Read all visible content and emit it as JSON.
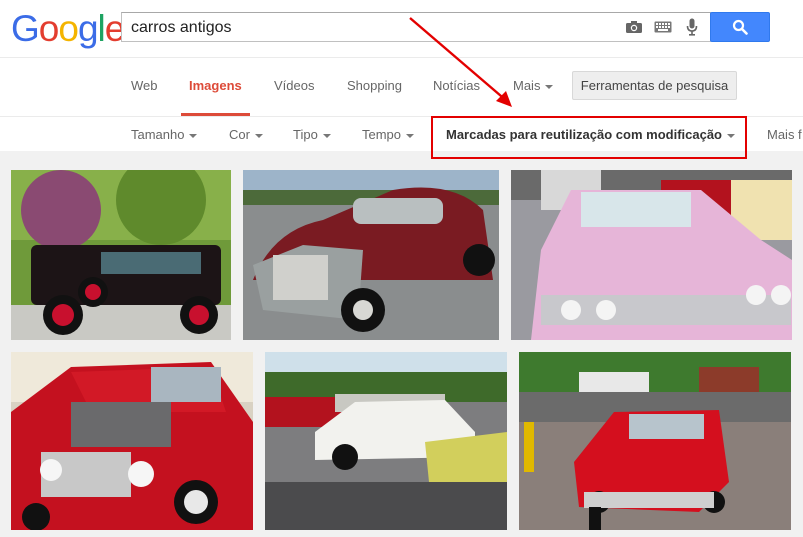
{
  "logo": {
    "letters": [
      "G",
      "o",
      "o",
      "g",
      "l",
      "e"
    ],
    "colors": [
      "#3b6ce7",
      "#e33d2f",
      "#f4b400",
      "#3b6ce7",
      "#1ea362",
      "#e33d2f"
    ]
  },
  "search": {
    "query": "carros antigos"
  },
  "nav": {
    "tabs": [
      "Web",
      "Imagens",
      "Vídeos",
      "Shopping",
      "Notícias",
      "Mais"
    ],
    "active_tab": "Imagens",
    "tools": "Ferramentas de pesquisa"
  },
  "filters": {
    "items": [
      "Tamanho",
      "Cor",
      "Tipo",
      "Tempo",
      "Marcadas para reutilização com modificação",
      "Mais f"
    ],
    "selected": "Marcadas para reutilização com modificação"
  },
  "colors": {
    "accent_red": "#dd4b39",
    "blue_button": "#4387fd",
    "highlight_box": "#e30000"
  }
}
